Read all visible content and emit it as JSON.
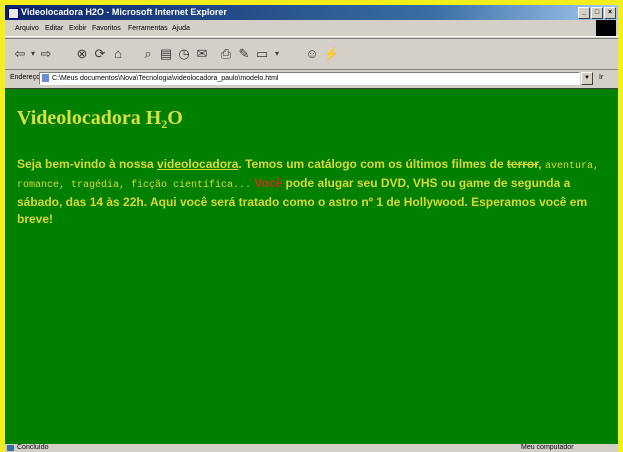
{
  "window": {
    "title": "Videolocadora H2O - Microsoft Internet Explorer",
    "controls": [
      "_",
      "□",
      "×"
    ]
  },
  "menu": [
    "Arquivo",
    "Editar",
    "Exibir",
    "Favoritos",
    "Ferramentas",
    "Ajuda"
  ],
  "toolbar": {
    "icons": [
      "back-icon",
      "forward-icon",
      "stop-icon",
      "refresh-icon",
      "home-icon",
      "search-icon",
      "favorites-icon",
      "history-icon",
      "mail-icon",
      "print-icon",
      "edit-icon",
      "discuss-icon",
      "messenger-icon"
    ]
  },
  "address": {
    "label": "Endereço",
    "url": "C:\\Meus documentos\\Nova\\Tecnologia\\videolocadora_paulo\\modelo.html",
    "go": "Ir"
  },
  "page": {
    "title_prefix": "Videolocadora H",
    "title_sub": "2",
    "title_suffix": "O",
    "p1": "Seja bem-vindo à nossa ",
    "link": "videolocadora",
    "p2": ". Temos um catálogo com os últimos filmes de ",
    "strike": "terror",
    "p3": ", ",
    "mono": "aventura, romance, tragédia, ficção científica...",
    "p4": " ",
    "red": "Você",
    "p5": " pode alugar seu DVD, VHS ou game de segunda a sábado, das 14 às 22h. Aqui você será tratado como o astro nº 1 de Hollywood. Esperamos você em breve!"
  },
  "status": {
    "left": "Concluído",
    "right": "Meu computador"
  },
  "colors": {
    "page_background": "#008000",
    "text": "#d8d834",
    "accent_red": "#c83218",
    "frame": "#f4ee1c"
  }
}
